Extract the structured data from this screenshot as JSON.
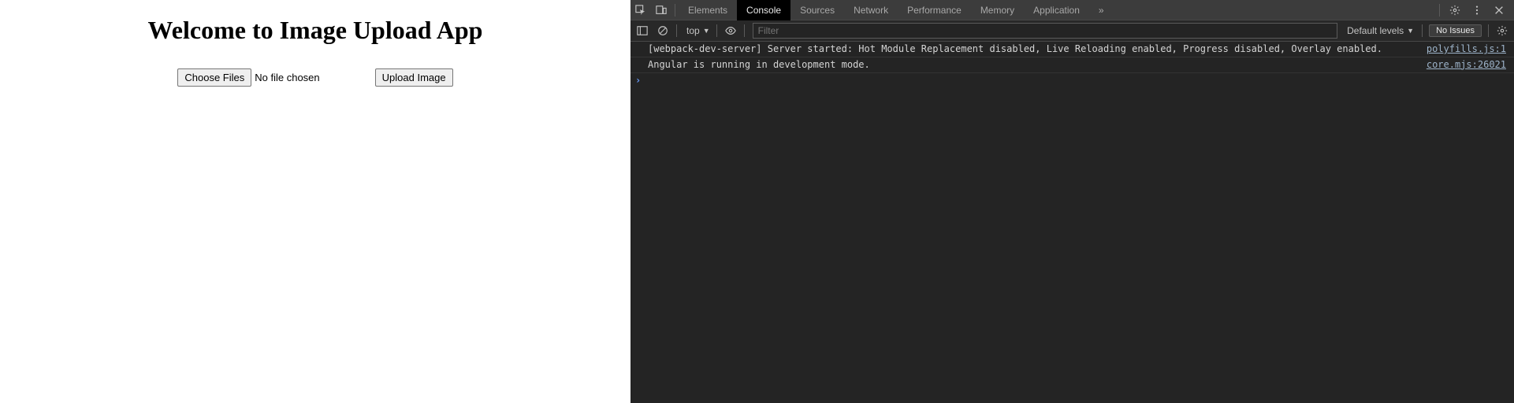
{
  "app": {
    "title": "Welcome to Image Upload App",
    "choose_label": "Choose Files",
    "file_status": "No file chosen",
    "upload_label": "Upload Image"
  },
  "devtools": {
    "tabs": {
      "elements": "Elements",
      "console": "Console",
      "sources": "Sources",
      "network": "Network",
      "performance": "Performance",
      "memory": "Memory",
      "application": "Application"
    },
    "more_tabs": "»",
    "toolbar": {
      "context": "top",
      "filter_placeholder": "Filter",
      "levels": "Default levels",
      "issues": "No Issues"
    },
    "logs": [
      {
        "message": "[webpack-dev-server] Server started: Hot Module Replacement disabled, Live Reloading enabled, Progress disabled, Overlay enabled.",
        "source": "polyfills.js:1"
      },
      {
        "message": "Angular is running in development mode.",
        "source": "core.mjs:26021"
      }
    ],
    "prompt": "›"
  }
}
